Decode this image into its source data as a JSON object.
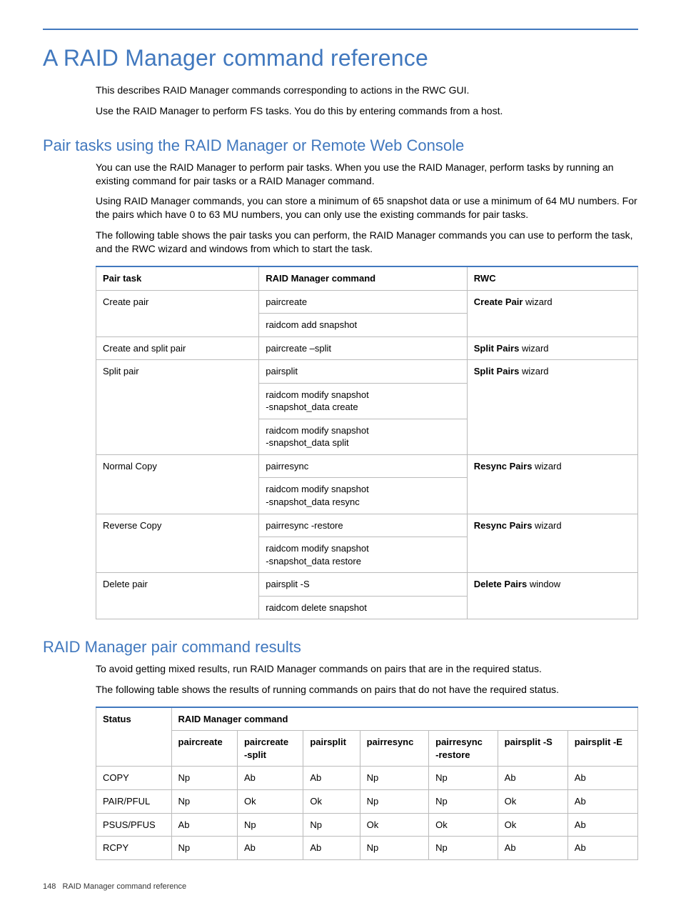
{
  "title": "A RAID Manager command reference",
  "intro": {
    "p1": "This describes RAID Manager commands corresponding to actions in the RWC GUI.",
    "p2": "Use the RAID Manager to perform FS tasks. You do this by entering commands from a host."
  },
  "section1": {
    "heading": "Pair tasks using the RAID Manager or Remote Web Console",
    "p1": "You can use the RAID Manager to perform pair tasks. When you use the RAID Manager, perform tasks by running an existing command for pair tasks or a RAID Manager command.",
    "p2": "Using RAID Manager commands, you can store a minimum of 65 snapshot data or use a minimum of 64 MU numbers. For the pairs which have 0 to 63 MU numbers, you can only use the existing commands for pair tasks.",
    "p3": "The following table shows the pair tasks you can perform, the RAID Manager commands you can use to perform the task, and the RWC wizard and windows from which to start the task."
  },
  "table1": {
    "headers": {
      "c1": "Pair task",
      "c2": "RAID Manager command",
      "c3": "RWC"
    },
    "rows": {
      "r1": {
        "task": "Create pair",
        "cmd1": "paircreate",
        "cmd2": "raidcom add snapshot",
        "rwc_b": "Create Pair",
        "rwc_t": " wizard"
      },
      "r2": {
        "task": "Create and split pair",
        "cmd1": "paircreate –split",
        "rwc_b": "Split Pairs",
        "rwc_t": " wizard"
      },
      "r3": {
        "task": "Split pair",
        "cmd1": "pairsplit",
        "cmd2a": "raidcom modify snapshot",
        "cmd2b": "-snapshot_data create",
        "cmd3a": "raidcom modify snapshot",
        "cmd3b": "-snapshot_data split",
        "rwc_b": "Split Pairs",
        "rwc_t": " wizard"
      },
      "r4": {
        "task": "Normal Copy",
        "cmd1": "pairresync",
        "cmd2a": "raidcom modify snapshot",
        "cmd2b": "-snapshot_data resync",
        "rwc_b": "Resync Pairs",
        "rwc_t": " wizard"
      },
      "r5": {
        "task": "Reverse Copy",
        "cmd1": "pairresync -restore",
        "cmd2a": "raidcom modify snapshot",
        "cmd2b": "-snapshot_data restore",
        "rwc_b": "Resync Pairs",
        "rwc_t": " wizard"
      },
      "r6": {
        "task": "Delete pair",
        "cmd1": "pairsplit -S",
        "cmd2": "raidcom delete snapshot",
        "rwc_b": "Delete Pairs",
        "rwc_t": " window"
      }
    }
  },
  "section2": {
    "heading": "RAID Manager pair command results",
    "p1": "To avoid getting mixed results, run RAID Manager commands on pairs that are in the required status.",
    "p2": "The following table shows the results of running commands on pairs that do not have the required status."
  },
  "table2": {
    "headers": {
      "status": "Status",
      "group": "RAID Manager command",
      "c1": "paircreate",
      "c2a": "paircreate",
      "c2b": "-split",
      "c3": "pairsplit",
      "c4": "pairresync",
      "c5a": "pairresync",
      "c5b": "-restore",
      "c6": "pairsplit -S",
      "c7": "pairsplit -E"
    },
    "rows": {
      "r1": {
        "s": "COPY",
        "v": [
          "Np",
          "Ab",
          "Ab",
          "Np",
          "Np",
          "Ab",
          "Ab"
        ]
      },
      "r2": {
        "s": "PAIR/PFUL",
        "v": [
          "Np",
          "Ok",
          "Ok",
          "Np",
          "Np",
          "Ok",
          "Ab"
        ]
      },
      "r3": {
        "s": "PSUS/PFUS",
        "v": [
          "Ab",
          "Np",
          "Np",
          "Ok",
          "Ok",
          "Ok",
          "Ab"
        ]
      },
      "r4": {
        "s": "RCPY",
        "v": [
          "Np",
          "Ab",
          "Ab",
          "Np",
          "Np",
          "Ab",
          "Ab"
        ]
      }
    }
  },
  "footer": {
    "page": "148",
    "label": "RAID Manager command reference"
  }
}
